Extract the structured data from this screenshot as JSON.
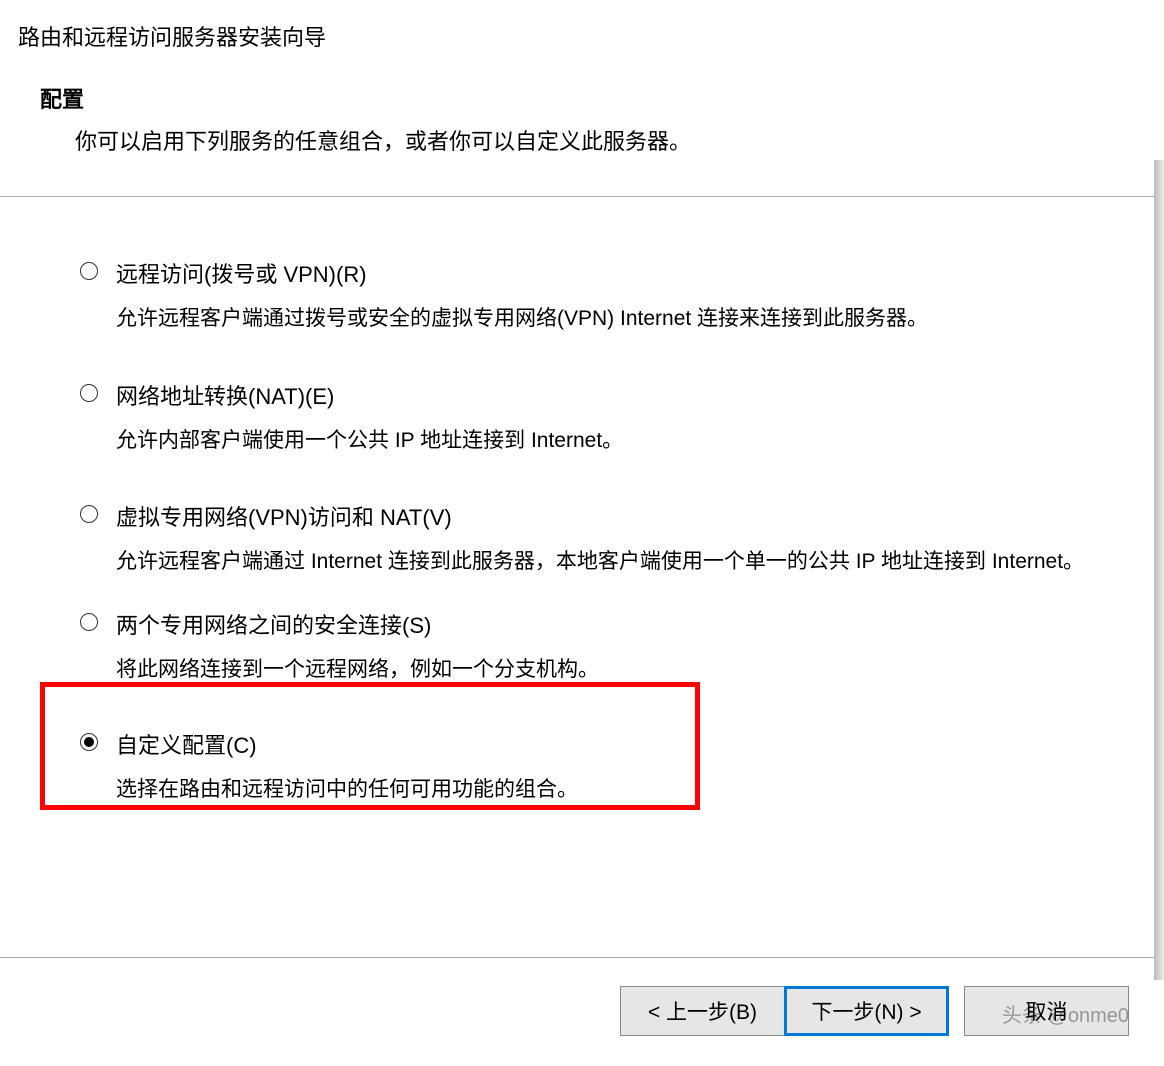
{
  "wizard": {
    "title": "路由和远程访问服务器安装向导"
  },
  "header": {
    "title": "配置",
    "subtitle": "你可以启用下列服务的任意组合，或者你可以自定义此服务器。"
  },
  "options": [
    {
      "title": "远程访问(拨号或 VPN)(R)",
      "desc": "允许远程客户端通过拨号或安全的虚拟专用网络(VPN) Internet 连接来连接到此服务器。",
      "selected": false
    },
    {
      "title": "网络地址转换(NAT)(E)",
      "desc": "允许内部客户端使用一个公共 IP 地址连接到 Internet。",
      "selected": false
    },
    {
      "title": "虚拟专用网络(VPN)访问和 NAT(V)",
      "desc": "允许远程客户端通过 Internet 连接到此服务器，本地客户端使用一个单一的公共 IP 地址连接到 Internet。",
      "selected": false
    },
    {
      "title": "两个专用网络之间的安全连接(S)",
      "desc": "将此网络连接到一个远程网络，例如一个分支机构。",
      "selected": false
    },
    {
      "title": "自定义配置(C)",
      "desc": "选择在路由和远程访问中的任何可用功能的组合。",
      "selected": true
    }
  ],
  "buttons": {
    "back": "< 上一步(B)",
    "next": "下一步(N) >",
    "cancel": "取消"
  },
  "watermark": "头条 @onme0"
}
